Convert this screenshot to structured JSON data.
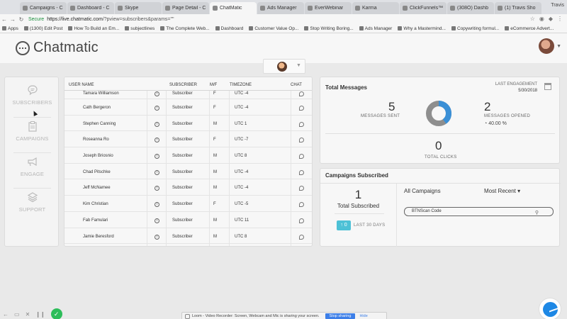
{
  "browser": {
    "tabs": [
      {
        "label": "Campaigns - C",
        "active": false
      },
      {
        "label": "Dashboard - C",
        "active": false
      },
      {
        "label": "Skype",
        "active": false
      },
      {
        "label": "Page Detail - C",
        "active": false
      },
      {
        "label": "ChatMatic",
        "active": true
      },
      {
        "label": "Ads Manager",
        "active": false
      },
      {
        "label": "EverWebinar",
        "active": false
      },
      {
        "label": "Karma",
        "active": false
      },
      {
        "label": "ClickFunnels™",
        "active": false
      },
      {
        "label": "(308O) Dashb",
        "active": false
      },
      {
        "label": "(1) Travis Sho",
        "active": false
      }
    ],
    "window_user": "Travis",
    "secure_label": "Secure",
    "url_host": "https://live.chatmatic.com",
    "url_path": "/?pview=subscribers&params=\"\"",
    "bookmarks": [
      "Apps",
      "(1300) Edit Post",
      "How To Build an Em...",
      "subjectlines",
      "The Complete Web...",
      "Dashboard",
      "Customer Value Op...",
      "Stop Writing Boring...",
      "Ads Manager",
      "Why a Mastermind...",
      "Copywriting formul...",
      "eCommerce Advert..."
    ]
  },
  "app": {
    "brand": "Chatmatic"
  },
  "sidebar": {
    "items": [
      {
        "label": "SUBSCRIBERS",
        "icon": "chat-bubble-icon"
      },
      {
        "label": "CAMPAIGNS",
        "icon": "clipboard-icon"
      },
      {
        "label": "ENGAGE",
        "icon": "megaphone-icon"
      },
      {
        "label": "SUPPORT",
        "icon": "layers-icon"
      }
    ]
  },
  "table": {
    "headers": {
      "name": "USER NAME",
      "subscriber": "SUBSCRIBER",
      "mf": "M/F",
      "timezone": "TIMEZONE",
      "chat": "CHAT"
    },
    "rows": [
      {
        "name": "Tamara Williamson",
        "type": "Subscriber",
        "gender": "F",
        "tz": "UTC -4"
      },
      {
        "name": "Cath Bergeron",
        "type": "Subscriber",
        "gender": "F",
        "tz": "UTC -4"
      },
      {
        "name": "Stephen Canning",
        "type": "Subscriber",
        "gender": "M",
        "tz": "UTC 1"
      },
      {
        "name": "Roseanna Ro",
        "type": "Subscriber",
        "gender": "F",
        "tz": "UTC -7"
      },
      {
        "name": "Joseph Briosnio",
        "type": "Subscriber",
        "gender": "M",
        "tz": "UTC 8"
      },
      {
        "name": "Chad Pitschke",
        "type": "Subscriber",
        "gender": "M",
        "tz": "UTC -4"
      },
      {
        "name": "Jeff McNamee",
        "type": "Subscriber",
        "gender": "M",
        "tz": "UTC -4"
      },
      {
        "name": "Kim Christian",
        "type": "Subscriber",
        "gender": "F",
        "tz": "UTC -5"
      },
      {
        "name": "Fab Famulari",
        "type": "Subscriber",
        "gender": "M",
        "tz": "UTC 11"
      },
      {
        "name": "Jamie Beresford",
        "type": "Subscriber",
        "gender": "M",
        "tz": "UTC 8"
      }
    ]
  },
  "total_messages": {
    "title": "Total Messages",
    "last_engagement_label": "LAST ENGAGEMENT",
    "last_engagement_date": "5/30/2018",
    "sent_value": "5",
    "sent_label": "MESSAGES SENT",
    "opened_value": "2",
    "opened_label": "MESSAGES OPENED",
    "opened_pct": "40.00 %",
    "clicks_value": "0",
    "clicks_label": "TOTAL CLICKS",
    "donut_opened_fraction": 0.4,
    "colors": {
      "opened": "#3a8fd6",
      "unopened": "#8e8e8e"
    }
  },
  "campaigns_subscribed": {
    "title": "Campaigns Subscribed",
    "total_value": "1",
    "total_label": "Total Subscribed",
    "badge_value": "0",
    "days_label": "LAST 30 DAYS",
    "filter_all": "All Campaigns",
    "filter_sort": "Most Recent",
    "campaign_item": "BTNScan Code"
  },
  "loom": {
    "message": "Loom - Video Recorder: Screen, Webcam and Mic is sharing your screen.",
    "stop_label": "Stop sharing",
    "hide_label": "Hide"
  }
}
